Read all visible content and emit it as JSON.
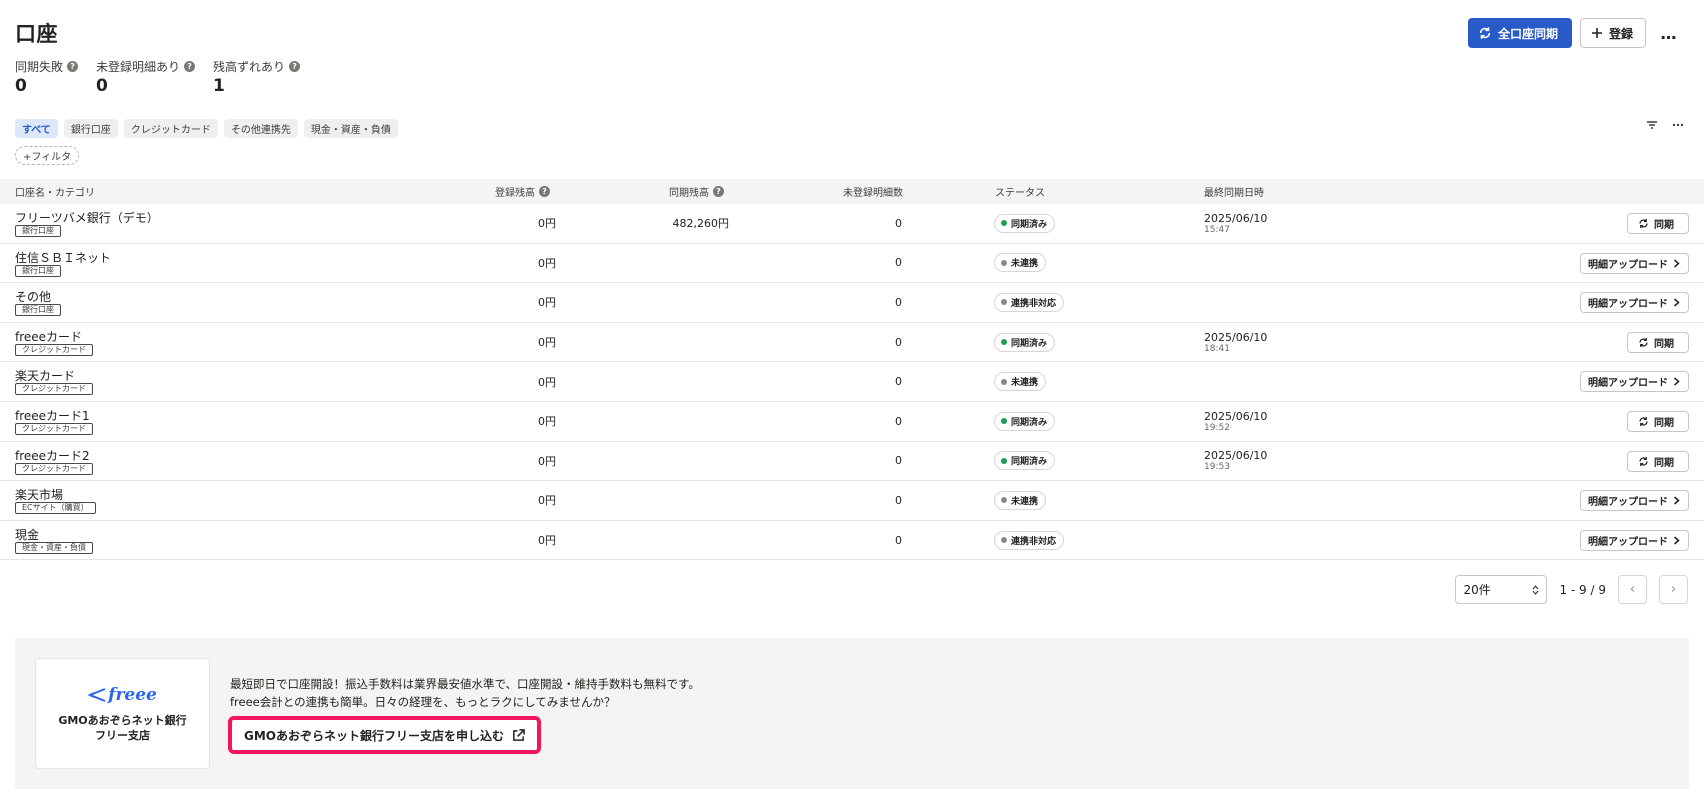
{
  "page": {
    "title": "口座"
  },
  "header": {
    "sync_all_label": "全口座同期",
    "register_label": "登録",
    "more_label": "…"
  },
  "stats": [
    {
      "label": "同期失敗",
      "value": "0"
    },
    {
      "label": "未登録明細あり",
      "value": "0"
    },
    {
      "label": "残高ずれあり",
      "value": "1"
    }
  ],
  "filters": {
    "chips": [
      "すべて",
      "銀行口座",
      "クレジットカード",
      "その他連携先",
      "現金・資産・負債"
    ],
    "add_filter": "+フィルタ"
  },
  "table": {
    "headers": {
      "name": "口座名・カテゴリ",
      "registered": "登録残高",
      "synced": "同期残高",
      "unregistered": "未登録明細数",
      "status": "ステータス",
      "last_sync": "最終同期日時"
    },
    "rows": [
      {
        "name": "フリーツバメ銀行（デモ）",
        "category": "銀行口座",
        "registered": "0円",
        "synced": "482,260円",
        "unregistered": "0",
        "status": "同期済み",
        "status_color": "#1f9d55",
        "sync_date": "2025/06/10",
        "sync_time": "15:47",
        "action": "同期",
        "action_type": "sync"
      },
      {
        "name": "住信ＳＢＩネット",
        "category": "銀行口座",
        "registered": "0円",
        "synced": "",
        "unregistered": "0",
        "status": "未連携",
        "status_color": "#8a8884",
        "sync_date": "",
        "sync_time": "",
        "action": "明細アップロード",
        "action_type": "upload"
      },
      {
        "name": "その他",
        "category": "銀行口座",
        "registered": "0円",
        "synced": "",
        "unregistered": "0",
        "status": "連携非対応",
        "status_color": "#8a8884",
        "sync_date": "",
        "sync_time": "",
        "action": "明細アップロード",
        "action_type": "upload"
      },
      {
        "name": "freeeカード",
        "category": "クレジットカード",
        "registered": "0円",
        "synced": "",
        "unregistered": "0",
        "status": "同期済み",
        "status_color": "#1f9d55",
        "sync_date": "2025/06/10",
        "sync_time": "18:41",
        "action": "同期",
        "action_type": "sync"
      },
      {
        "name": "楽天カード",
        "category": "クレジットカード",
        "registered": "0円",
        "synced": "",
        "unregistered": "0",
        "status": "未連携",
        "status_color": "#8a8884",
        "sync_date": "",
        "sync_time": "",
        "action": "明細アップロード",
        "action_type": "upload"
      },
      {
        "name": "freeeカード1",
        "category": "クレジットカード",
        "registered": "0円",
        "synced": "",
        "unregistered": "0",
        "status": "同期済み",
        "status_color": "#1f9d55",
        "sync_date": "2025/06/10",
        "sync_time": "19:52",
        "action": "同期",
        "action_type": "sync"
      },
      {
        "name": "freeeカード2",
        "category": "クレジットカード",
        "registered": "0円",
        "synced": "",
        "unregistered": "0",
        "status": "同期済み",
        "status_color": "#1f9d55",
        "sync_date": "2025/06/10",
        "sync_time": "19:53",
        "action": "同期",
        "action_type": "sync"
      },
      {
        "name": "楽天市場",
        "category": "ECサイト（購買）",
        "registered": "0円",
        "synced": "",
        "unregistered": "0",
        "status": "未連携",
        "status_color": "#8a8884",
        "sync_date": "",
        "sync_time": "",
        "action": "明細アップロード",
        "action_type": "upload"
      },
      {
        "name": "現金",
        "category": "現金・資産・負債",
        "registered": "0円",
        "synced": "",
        "unregistered": "0",
        "status": "連携非対応",
        "status_color": "#8a8884",
        "sync_date": "",
        "sync_time": "",
        "action": "明細アップロード",
        "action_type": "upload"
      }
    ]
  },
  "pagination": {
    "per_page": "20件",
    "range": "1 - 9 / 9"
  },
  "promo": {
    "logo_text": "freee",
    "card_title_line1": "GMOあおぞらネット銀行",
    "card_title_line2": "フリー支店",
    "text_line1": "最短即日で口座開設！振込手数料は業界最安値水準で、口座開設・維持手数料も無料です。",
    "text_line2": "freee会計との連携も簡単。日々の経理を、もっとラクにしてみませんか？",
    "button_label": "GMOあおぞらネット銀行フリー支店を申し込む"
  },
  "colors": {
    "primary": "#285ac8",
    "highlight": "#f3165f",
    "synced": "#1f9d55",
    "unlinked": "#8a8884"
  }
}
